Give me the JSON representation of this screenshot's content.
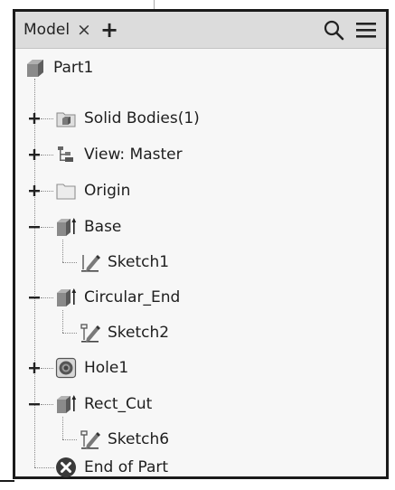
{
  "panel": {
    "tab_label": "Model",
    "close_glyph": "×",
    "add_glyph": "+"
  },
  "icons": {
    "search": "search-icon",
    "menu": "hamburger-menu-icon"
  },
  "tree": {
    "root": {
      "label": "Part1",
      "icon": "part-icon"
    },
    "items": [
      {
        "label": "Solid Bodies(1)",
        "icon": "solid-bodies-folder-icon",
        "expander": "+"
      },
      {
        "label": "View: Master",
        "icon": "view-representation-icon",
        "expander": "+"
      },
      {
        "label": "Origin",
        "icon": "folder-icon",
        "expander": "+"
      },
      {
        "label": "Base",
        "icon": "extrusion-icon",
        "expander": "−",
        "child": {
          "label": "Sketch1",
          "icon": "sketch-icon"
        }
      },
      {
        "label": "Circular_End",
        "icon": "extrusion-icon",
        "expander": "−",
        "child": {
          "label": "Sketch2",
          "icon": "sketch-icon"
        }
      },
      {
        "label": "Hole1",
        "icon": "hole-icon",
        "expander": "+"
      },
      {
        "label": "Rect_Cut",
        "icon": "extrusion-icon",
        "expander": "−",
        "child": {
          "label": "Sketch6",
          "icon": "sketch-icon"
        }
      },
      {
        "label": "End of Part",
        "icon": "end-of-part-icon"
      }
    ]
  },
  "colors": {
    "header_bg": "#dcdcdc",
    "panel_bg": "#f7f7f7",
    "end_of_part": "#3a3a3a",
    "solid_gray": "#8a8a8a"
  }
}
